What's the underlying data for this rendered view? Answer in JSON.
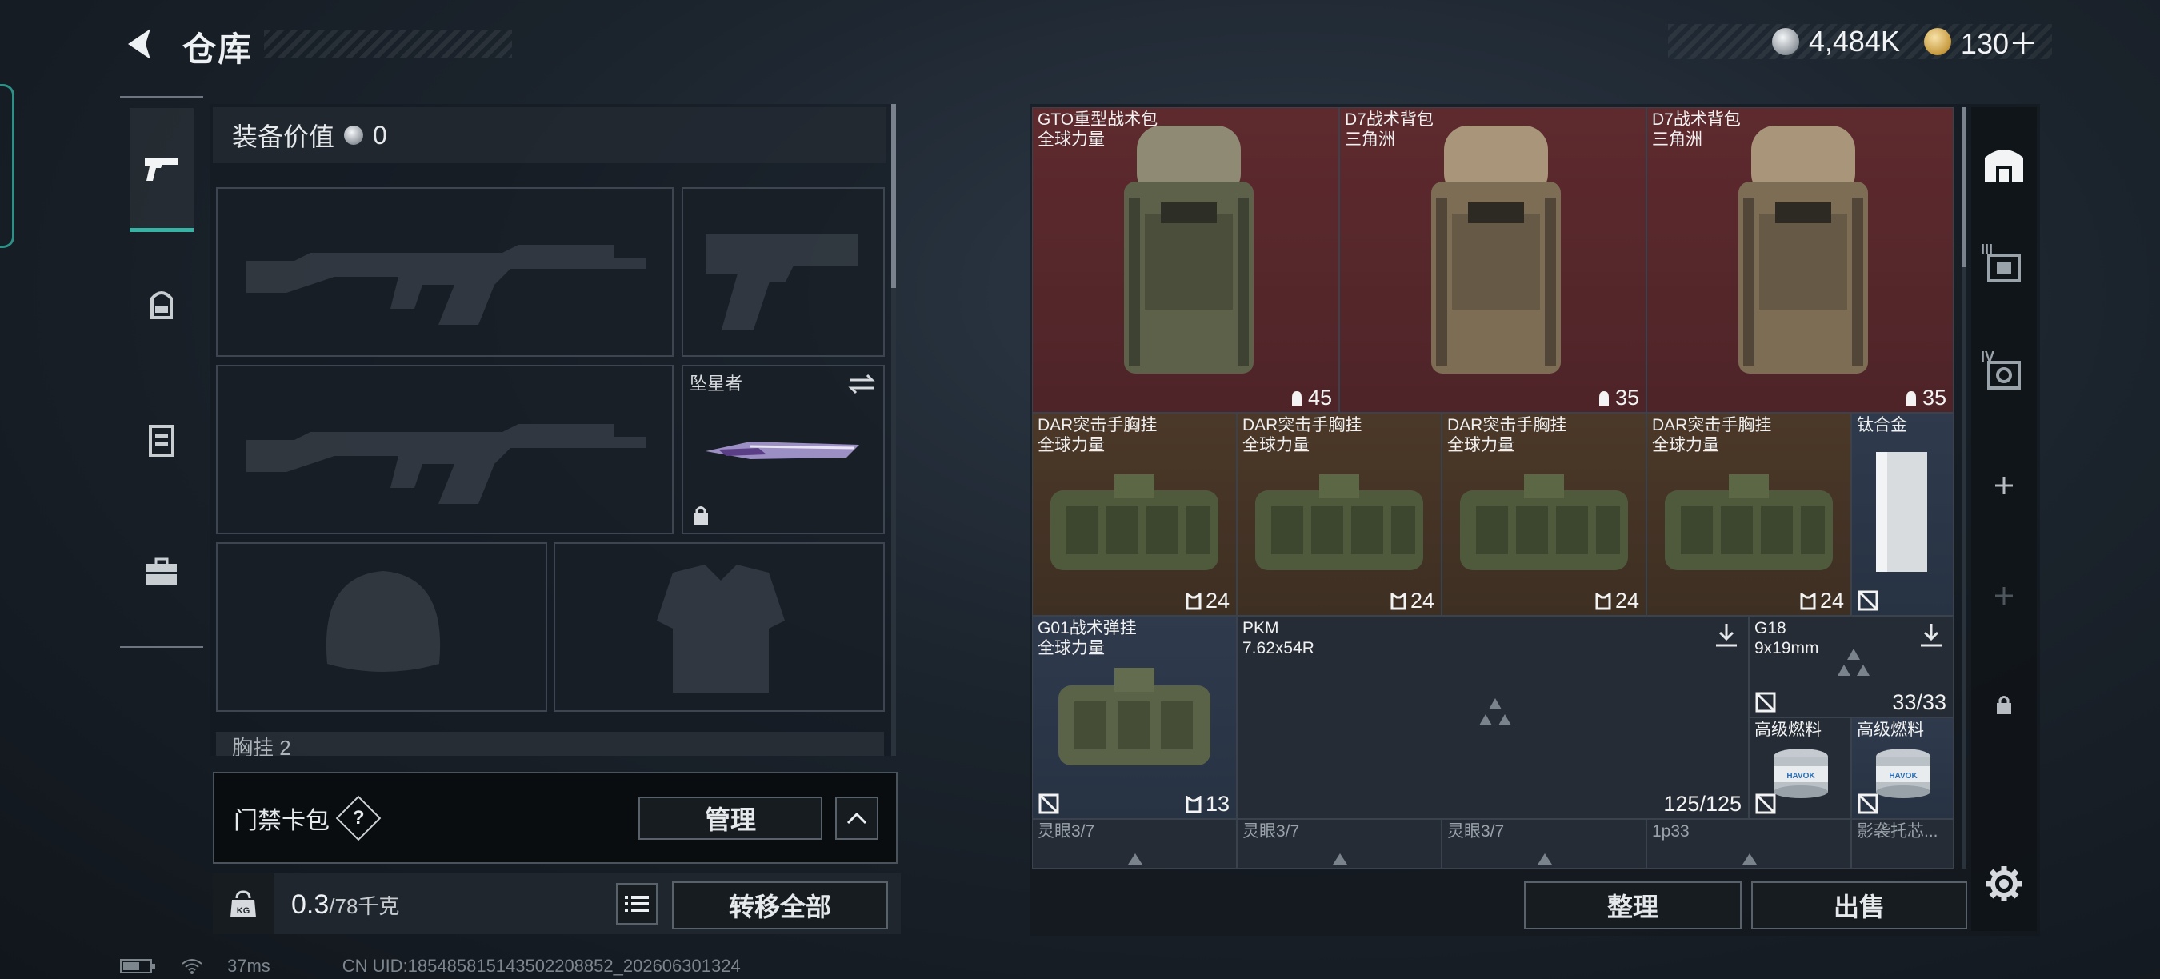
{
  "header": {
    "title": "仓库",
    "currencies": [
      {
        "icon": "silver-coin-icon",
        "value": "4,484K"
      },
      {
        "icon": "gold-coin-icon",
        "value": "130＋"
      }
    ]
  },
  "equipment": {
    "value_label": "装备价值",
    "value": "0",
    "melee_slot_label": "坠星者",
    "chest_label_partial": "胸挂 2",
    "keycard_label": "门禁卡包",
    "help_label": "?",
    "manage_label": "管理",
    "weight_value": "0.3",
    "weight_max": "/78千克",
    "transfer_all_label": "转移全部"
  },
  "stash": {
    "items": [
      {
        "id": "gto-pack",
        "name": "GTO重型战术包",
        "sub": "全球力量",
        "count": "45",
        "color": "red"
      },
      {
        "id": "d7-pack-1",
        "name": "D7战术背包",
        "sub": "三角洲",
        "count": "35",
        "color": "red"
      },
      {
        "id": "d7-pack-2",
        "name": "D7战术背包",
        "sub": "三角洲",
        "count": "35",
        "color": "red"
      },
      {
        "id": "dar-rig-1",
        "name": "DAR突击手胸挂",
        "sub": "全球力量",
        "count": "24",
        "color": "brown"
      },
      {
        "id": "dar-rig-2",
        "name": "DAR突击手胸挂",
        "sub": "全球力量",
        "count": "24",
        "color": "brown"
      },
      {
        "id": "dar-rig-3",
        "name": "DAR突击手胸挂",
        "sub": "全球力量",
        "count": "24",
        "color": "brown"
      },
      {
        "id": "dar-rig-4",
        "name": "DAR突击手胸挂",
        "sub": "全球力量",
        "count": "24",
        "color": "brown"
      },
      {
        "id": "titanium",
        "name": "钛合金",
        "sub": "",
        "count": "",
        "color": "blue"
      },
      {
        "id": "g01-rig",
        "name": "G01战术弹挂",
        "sub": "全球力量",
        "count": "13",
        "color": "blue"
      },
      {
        "id": "pkm-ammo",
        "name": "PKM",
        "sub": "7.62x54R",
        "count": "125/125",
        "color": "dark"
      },
      {
        "id": "g18-ammo",
        "name": "G18",
        "sub": "9x19mm",
        "count": "33/33",
        "color": "dark"
      },
      {
        "id": "fuel-1",
        "name": "高级燃料",
        "sub": "",
        "count": "",
        "color": "dark"
      },
      {
        "id": "fuel-2",
        "name": "高级燃料",
        "sub": "",
        "count": "",
        "color": "dark"
      },
      {
        "id": "row5-1",
        "name": "灵眼3/7",
        "sub": "",
        "count": "",
        "color": "dark"
      },
      {
        "id": "row5-2",
        "name": "灵眼3/7",
        "sub": "",
        "count": "",
        "color": "dark"
      },
      {
        "id": "row5-3",
        "name": "灵眼3/7",
        "sub": "",
        "count": "",
        "color": "dark"
      },
      {
        "id": "row5-4",
        "name": "1p33",
        "sub": "",
        "count": "",
        "color": "dark"
      },
      {
        "id": "row5-5",
        "name": "影袭托芯...",
        "sub": "",
        "count": "",
        "color": "dark"
      }
    ],
    "sort_label": "整理",
    "sell_label": "出售",
    "side_labels": [
      "III",
      "IV"
    ]
  },
  "status": {
    "ping": "37ms",
    "uid": "CN UID:18548581514350220885​2_202606301324"
  },
  "colors": {
    "accent": "#35b3a5",
    "red_rarity": "#5e2a2e",
    "brown_rarity": "#4b3828",
    "blue_rarity": "#2f3b4d"
  }
}
